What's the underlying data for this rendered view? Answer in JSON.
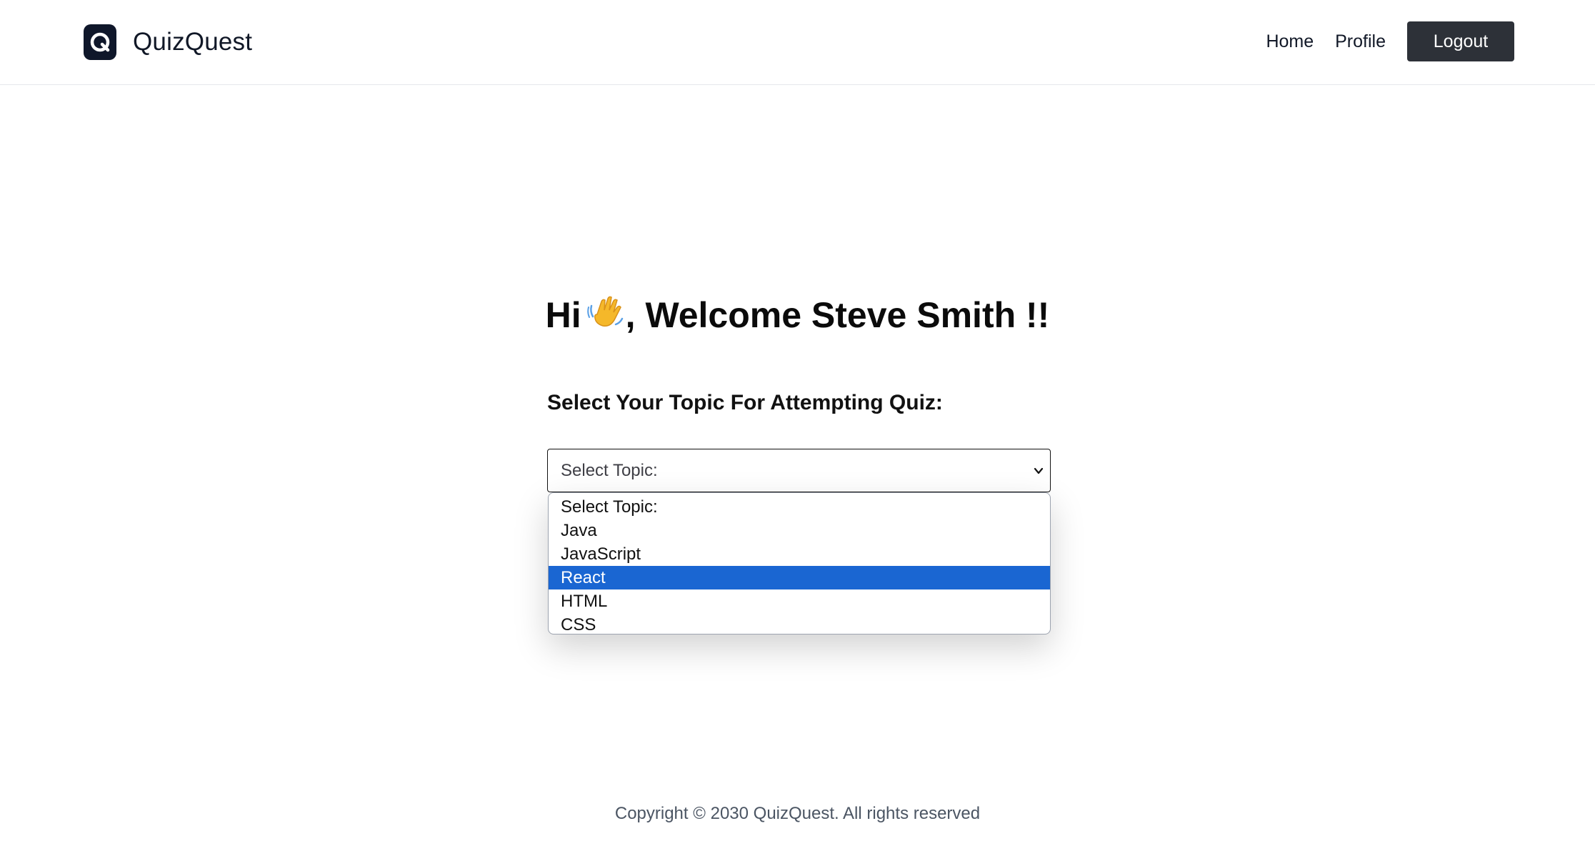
{
  "header": {
    "brand_name": "QuizQuest",
    "nav": {
      "home": "Home",
      "profile": "Profile",
      "logout": "Logout"
    }
  },
  "main": {
    "greeting_prefix": "Hi",
    "greeting_suffix": ", Welcome Steve Smith !!",
    "select_label": "Select Your Topic For Attempting Quiz:",
    "select_value": "Select Topic:",
    "options": [
      "Select Topic:",
      "Java",
      "JavaScript",
      "React",
      "HTML",
      "CSS"
    ],
    "highlighted_option": "React"
  },
  "footer": {
    "copyright": "Copyright © 2030 QuizQuest. All rights reserved"
  },
  "colors": {
    "brand_dark": "#0f172a",
    "logout_bg": "#2d3138",
    "highlight": "#1a66d2"
  },
  "icons": {
    "logo": "q-logo-icon",
    "wave": "waving-hand-icon",
    "select": "chevron-down-icon"
  }
}
